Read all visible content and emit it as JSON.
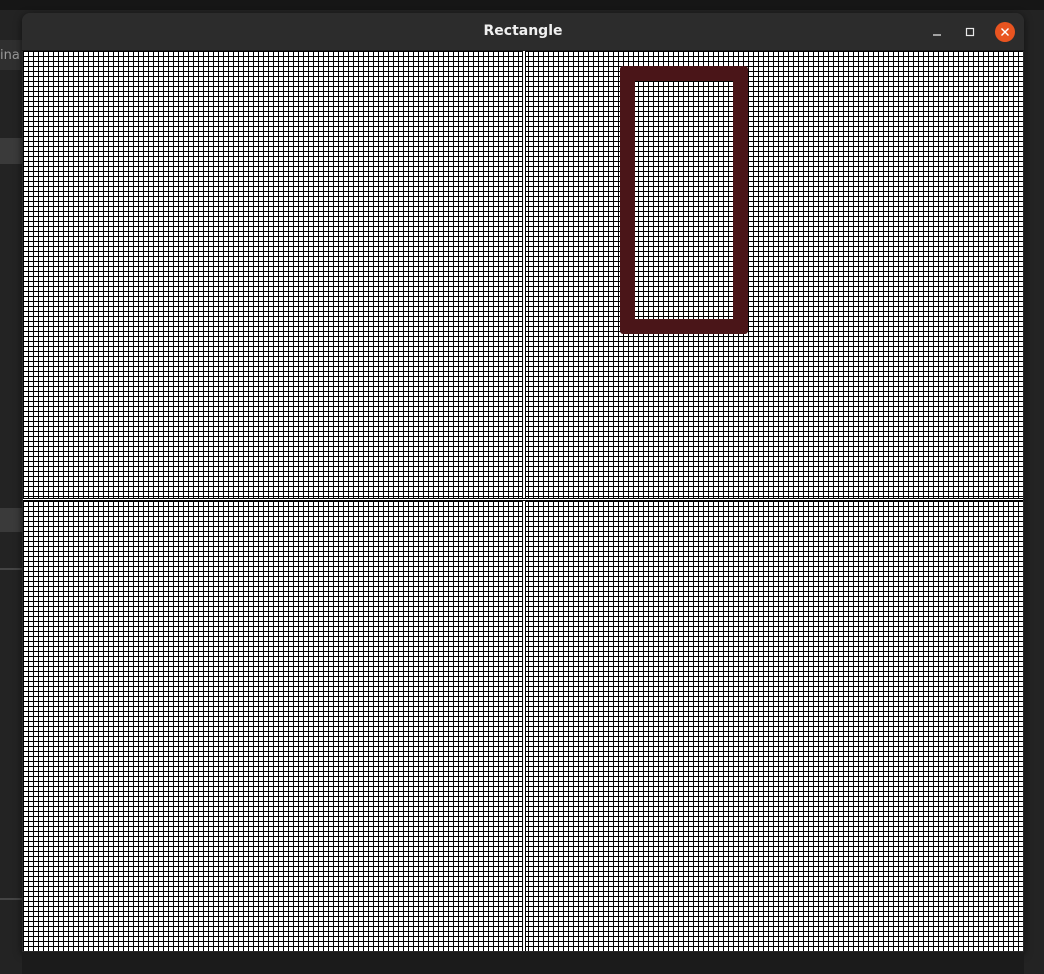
{
  "window": {
    "title": "Rectangle",
    "controls": {
      "minimize_icon": "minimize-icon",
      "maximize_icon": "maximize-icon",
      "close_icon": "close-icon",
      "close_color": "#e95420"
    }
  },
  "background_app": {
    "partial_text": "ina"
  },
  "canvas": {
    "background_color": "#ffffff",
    "grid_color": "#000000",
    "rectangle": {
      "stroke_color": "#4a1518",
      "fill": "none"
    }
  }
}
